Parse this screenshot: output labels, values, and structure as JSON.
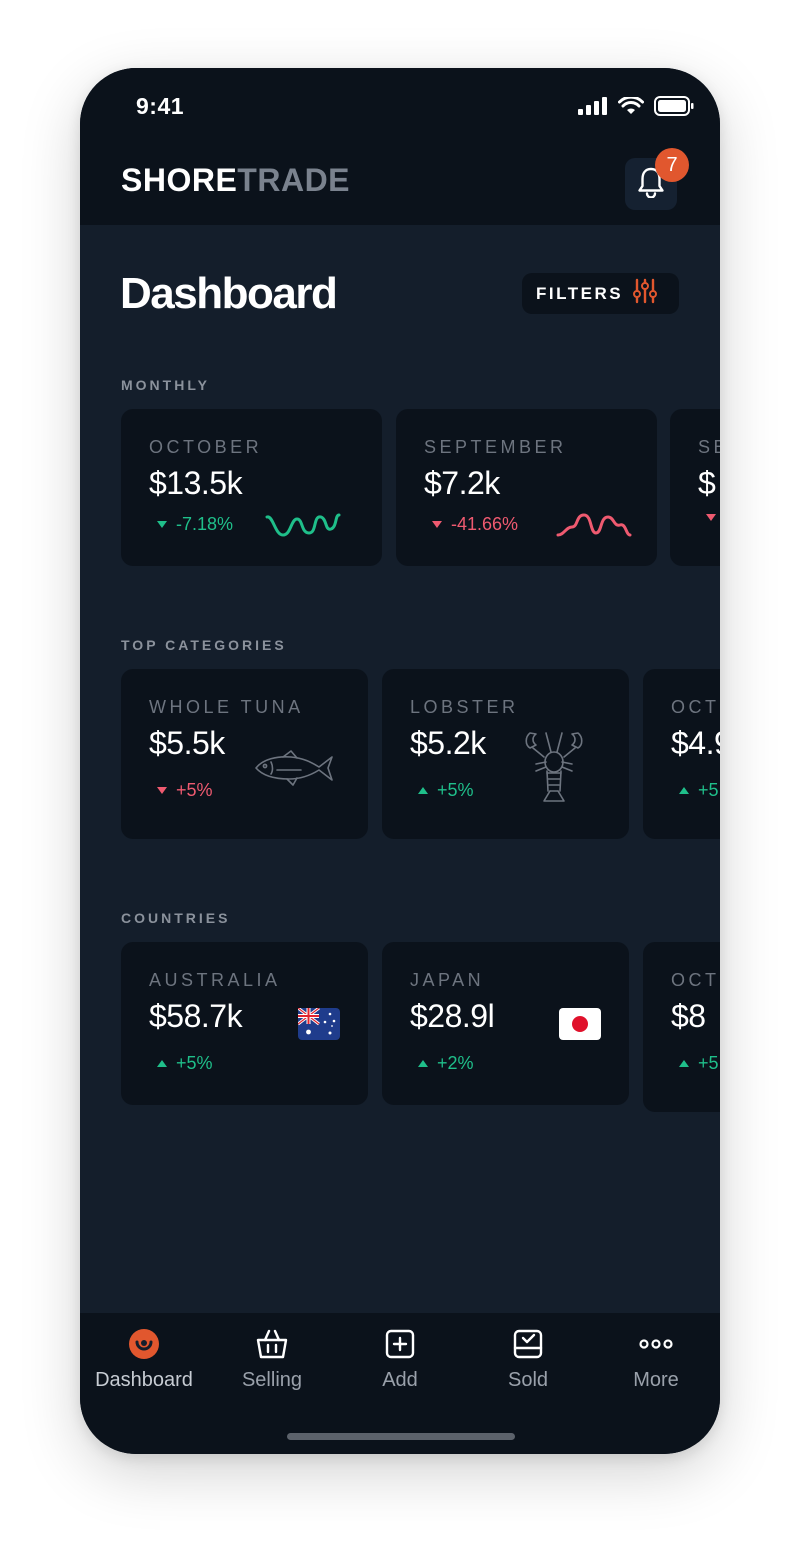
{
  "status_bar": {
    "time": "9:41"
  },
  "header": {
    "logo_part1": "SHORE",
    "logo_part2": "TRADE",
    "notification_count": "7"
  },
  "page": {
    "title": "Dashboard",
    "filters_label": "FILTERS"
  },
  "sections": {
    "monthly": {
      "label": "MONTHLY",
      "cards": [
        {
          "label": "OCTOBER",
          "value": "$13.5k",
          "change": "-7.18%",
          "direction": "down",
          "trend_color": "#1fbf8a"
        },
        {
          "label": "SEPTEMBER",
          "value": "$7.2k",
          "change": "-41.66%",
          "direction": "down",
          "trend_color": "#ef5a70"
        },
        {
          "label": "SE",
          "value": "$"
        }
      ]
    },
    "top_categories": {
      "label": "TOP CATEGORIES",
      "cards": [
        {
          "label": "WHOLE TUNA",
          "value": "$5.5k",
          "change": "+5%",
          "direction": "down",
          "icon": "tuna-icon"
        },
        {
          "label": "LOBSTER",
          "value": "$5.2k",
          "change": "+5%",
          "direction": "up",
          "icon": "lobster-icon"
        },
        {
          "label": "OCT",
          "value": "$4.9",
          "change": "+5"
        }
      ]
    },
    "countries": {
      "label": "COUNTRIES",
      "cards": [
        {
          "label": "AUSTRALIA",
          "value": "$58.7k",
          "change": "+5%",
          "direction": "up",
          "icon": "australia-flag-icon"
        },
        {
          "label": "JAPAN",
          "value": "$28.9l",
          "change": "+2%",
          "direction": "up",
          "icon": "japan-flag-icon"
        },
        {
          "label": "OCT",
          "value": "$8",
          "change": "+5"
        }
      ]
    }
  },
  "nav": [
    {
      "label": "Dashboard",
      "icon": "dashboard-icon",
      "active": true
    },
    {
      "label": "Selling",
      "icon": "basket-icon"
    },
    {
      "label": "Add",
      "icon": "add-icon"
    },
    {
      "label": "Sold",
      "icon": "sold-icon"
    },
    {
      "label": "More",
      "icon": "more-icon"
    }
  ],
  "colors": {
    "accent": "#e1572e",
    "background": "#141e2b",
    "card": "#0b121b",
    "positive": "#1fbf8a",
    "negative": "#ef5a70"
  }
}
